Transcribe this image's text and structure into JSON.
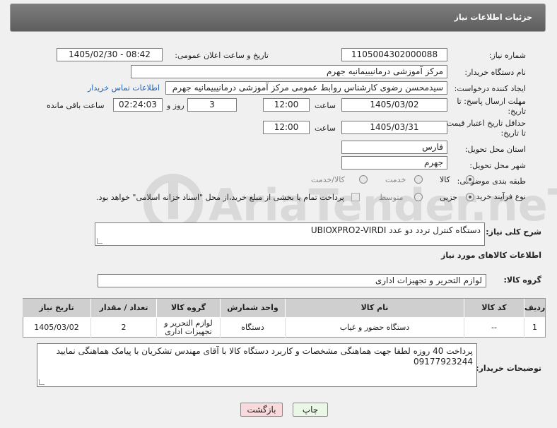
{
  "header": {
    "title": "جزئیات اطلاعات نیاز"
  },
  "fields": {
    "need_number": {
      "label": "شماره نیاز:",
      "value": "1105004302000088"
    },
    "announce": {
      "label": "تاریخ و ساعت اعلان عمومی:",
      "value": "1405/02/30 - 08:42"
    },
    "buyer": {
      "label": "نام دستگاه خریدار:",
      "value": "مرکز آموزشی درمانیبیمانیه جهرم"
    },
    "creator": {
      "label": "ایجاد کننده درخواست:",
      "value": "سیدمحسن رضوی کارشناس روابط عمومی مرکز آموزشی درمانیبیمانیه جهرم",
      "contact_link": "اطلاعات تماس خریدار"
    },
    "deadline": {
      "label_line1": "مهلت ارسال پاسخ: تا",
      "label_line2": "تاریخ:",
      "date": "1405/03/02",
      "time_label": "ساعت",
      "time": "12:00",
      "days": "3",
      "days_label": "روز و",
      "remaining": "02:24:03",
      "remaining_label": "ساعت باقی مانده"
    },
    "validity": {
      "label_line1": "حداقل تاریخ اعتبار قیمت:",
      "label_line2": "تا تاریخ:",
      "date": "1405/03/31",
      "time_label": "ساعت",
      "time": "12:00"
    },
    "province": {
      "label": "استان محل تحویل:",
      "value": "فارس"
    },
    "city": {
      "label": "شهر محل تحویل:",
      "value": "جهرم"
    },
    "category": {
      "label": "طبقه بندی موضوعی:",
      "options": [
        "کالا",
        "خدمت",
        "کالا/خدمت"
      ],
      "selected": "کالا"
    },
    "process": {
      "label": "نوع فرآیند خرید :",
      "options": [
        "جزیی",
        "متوسط"
      ],
      "selected": "جزیی",
      "payment_note": "پرداخت تمام یا بخشی از مبلغ خرید،از محل \"اسناد خزانه اسلامی\" خواهد بود."
    }
  },
  "description": {
    "label": "شرح کلی نیاز:",
    "value": "دستگاه کنترل تردد دو عدد  UBIOXPRO2-VIRDI"
  },
  "goods_section": {
    "title": "اطلاعات کالاهای مورد نیاز"
  },
  "goods_group": {
    "label": "گروه کالا:",
    "value": "لوازم التحریر و تجهیزات اداری"
  },
  "table": {
    "headers": [
      "ردیف",
      "کد کالا",
      "نام کالا",
      "واحد شمارش",
      "گروه کالا",
      "تعداد / مقدار",
      "تاریخ نیاز"
    ],
    "rows": [
      [
        "1",
        "--",
        "دستگاه حضور و غیاب",
        "دستگاه",
        "لوازم التحریر و تجهیزات اداری",
        "2",
        "1405/03/02"
      ]
    ]
  },
  "buyer_notes": {
    "label": "توضیحات خریدار:",
    "value": "پرداخت 40 روزه  لطفا جهت هماهنگی مشخصات و کاربرد  دستگاه کالا با آقای مهندس تشکریان  با پیامک  هماهنگی نمایید 09177923244"
  },
  "buttons": {
    "print": "چاپ",
    "back": "بازگشت"
  },
  "watermark": {
    "text": "AriaTender.neT"
  },
  "colors": {
    "header_bg": "#6b6b6b",
    "link": "#1a5fb4",
    "back_button": "#f8d9dc",
    "print_button": "#eaf6e6"
  }
}
